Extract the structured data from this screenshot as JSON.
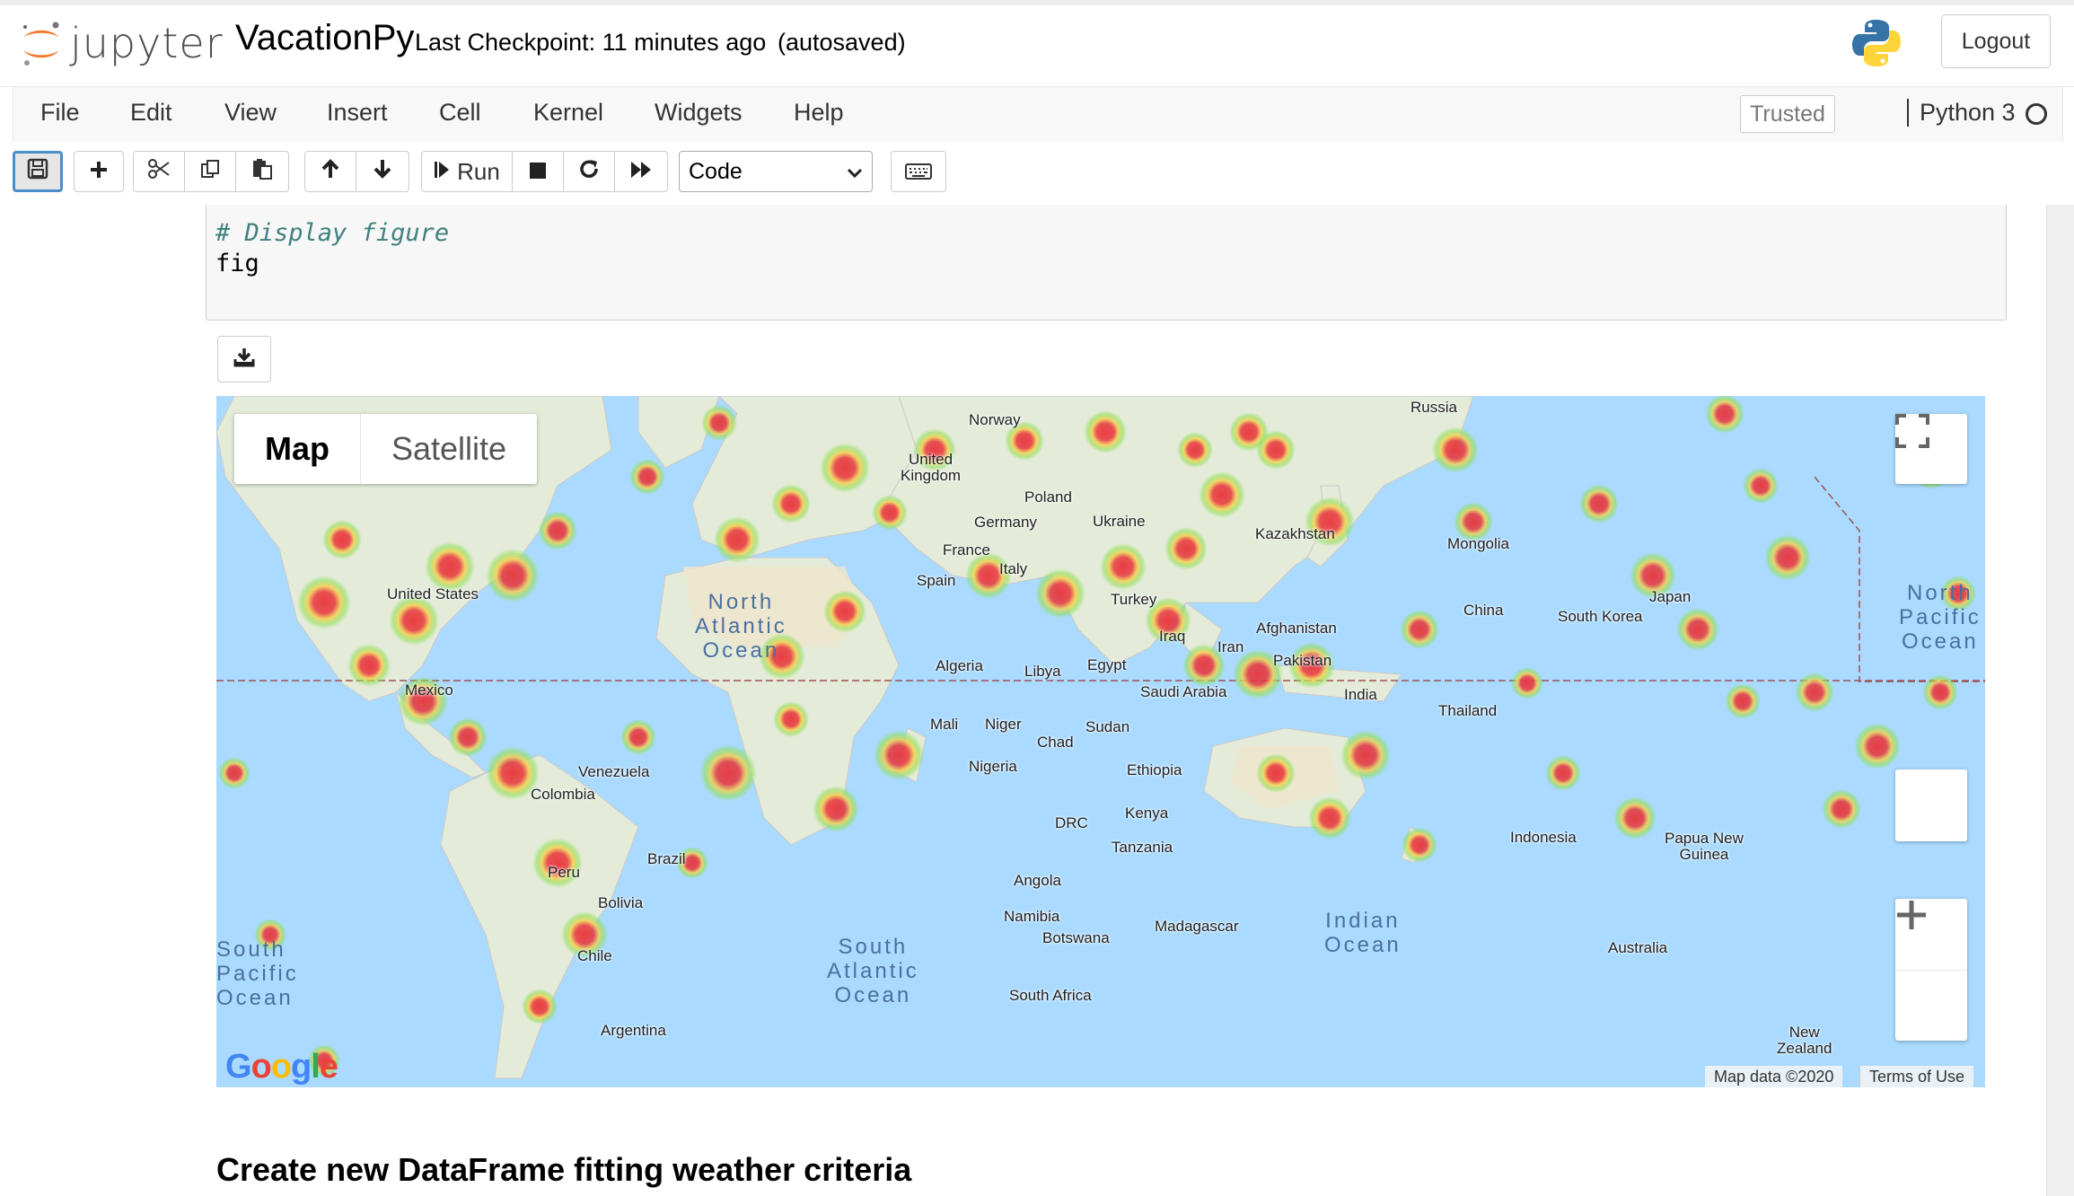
{
  "header": {
    "logo_text": "jupyter",
    "notebook_name": "VacationPy",
    "checkpoint": "Last Checkpoint: 11 minutes ago",
    "autosave": "(autosaved)",
    "logout_label": "Logout"
  },
  "menubar": {
    "items": [
      "File",
      "Edit",
      "View",
      "Insert",
      "Cell",
      "Kernel",
      "Widgets",
      "Help"
    ],
    "trusted": "Trusted",
    "kernel_name": "Python 3"
  },
  "toolbar": {
    "run_label": "Run",
    "cell_type": "Code",
    "icons": [
      "save-icon",
      "plus-icon",
      "cut-icon",
      "copy-icon",
      "paste-icon",
      "arrow-up-icon",
      "arrow-down-icon",
      "run-icon",
      "stop-icon",
      "restart-icon",
      "fast-forward-icon",
      "keyboard-icon"
    ]
  },
  "cell": {
    "comment": "# Display figure",
    "code": "fig"
  },
  "map": {
    "type_map": "Map",
    "type_satellite": "Satellite",
    "attribution": "Map data ©2020",
    "terms": "Terms of Use",
    "google": "Google",
    "labels": {
      "norway": "Norway",
      "russia": "Russia",
      "united_kingdom": "United\nKingdom",
      "poland": "Poland",
      "germany": "Germany",
      "ukraine": "Ukraine",
      "france": "France",
      "italy": "Italy",
      "spain": "Spain",
      "kazakhstan": "Kazakhstan",
      "mongolia": "Mongolia",
      "turkey": "Turkey",
      "united_states": "United States",
      "mexico": "Mexico",
      "algeria": "Algeria",
      "libya": "Libya",
      "egypt": "Egypt",
      "iraq": "Iraq",
      "iran": "Iran",
      "afghanistan": "Afghanistan",
      "pakistan": "Pakistan",
      "china": "China",
      "south_korea": "South Korea",
      "japan": "Japan",
      "saudi_arabia": "Saudi Arabia",
      "india": "India",
      "thailand": "Thailand",
      "mali": "Mali",
      "niger": "Niger",
      "chad": "Chad",
      "sudan": "Sudan",
      "nigeria": "Nigeria",
      "ethiopia": "Ethiopia",
      "venezuela": "Venezuela",
      "colombia": "Colombia",
      "kenya": "Kenya",
      "drc": "DRC",
      "tanzania": "Tanzania",
      "indonesia": "Indonesia",
      "papua": "Papua New\nGuinea",
      "brazil": "Brazil",
      "peru": "Peru",
      "angola": "Angola",
      "bolivia": "Bolivia",
      "namibia": "Namibia",
      "botswana": "Botswana",
      "madagascar": "Madagascar",
      "australia": "Australia",
      "chile": "Chile",
      "south_africa": "South Africa",
      "argentina": "Argentina",
      "new_zealand": "New\nZealand"
    },
    "oceans": {
      "north_atlantic": "North\nAtlantic\nOcean",
      "north_pacific": "North\nPacific\nOcean",
      "south_pacific": "South\nPacific\nOcean",
      "south_atlantic": "South\nAtlantic\nOcean",
      "indian": "Indian\nOcean"
    }
  },
  "next_heading": "Create new DataFrame fitting weather criteria"
}
